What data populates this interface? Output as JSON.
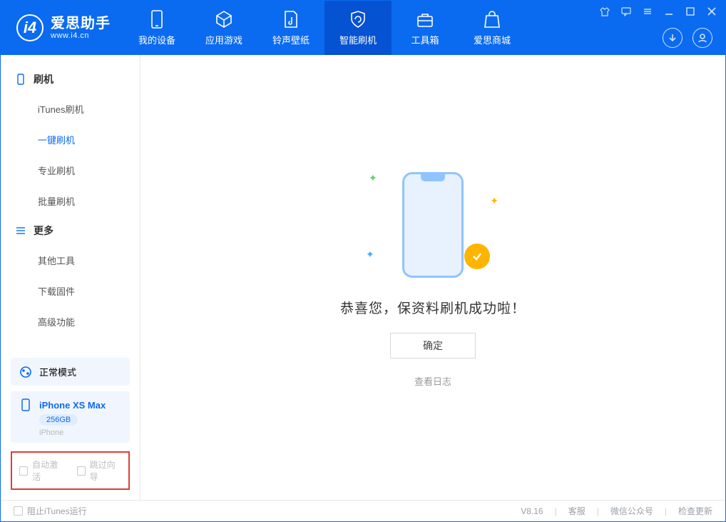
{
  "app": {
    "name_cn": "爱思助手",
    "name_en": "www.i4.cn"
  },
  "nav": {
    "items": [
      {
        "label": "我的设备"
      },
      {
        "label": "应用游戏"
      },
      {
        "label": "铃声壁纸"
      },
      {
        "label": "智能刷机"
      },
      {
        "label": "工具箱"
      },
      {
        "label": "爱思商城"
      }
    ]
  },
  "sidebar": {
    "group1_title": "刷机",
    "group1_items": [
      {
        "label": "iTunes刷机"
      },
      {
        "label": "一键刷机"
      },
      {
        "label": "专业刷机"
      },
      {
        "label": "批量刷机"
      }
    ],
    "group2_title": "更多",
    "group2_items": [
      {
        "label": "其他工具"
      },
      {
        "label": "下载固件"
      },
      {
        "label": "高级功能"
      }
    ],
    "mode_card": "正常模式",
    "device": {
      "name": "iPhone XS Max",
      "storage": "256GB",
      "sub": "iPhone"
    },
    "cb1": "自动激活",
    "cb2": "跳过向导"
  },
  "main": {
    "success_text": "恭喜您，保资料刷机成功啦！",
    "ok_label": "确定",
    "log_link": "查看日志"
  },
  "footer": {
    "left_cb": "阻止iTunes运行",
    "version": "V8.16",
    "links": [
      "客服",
      "微信公众号",
      "检查更新"
    ]
  }
}
